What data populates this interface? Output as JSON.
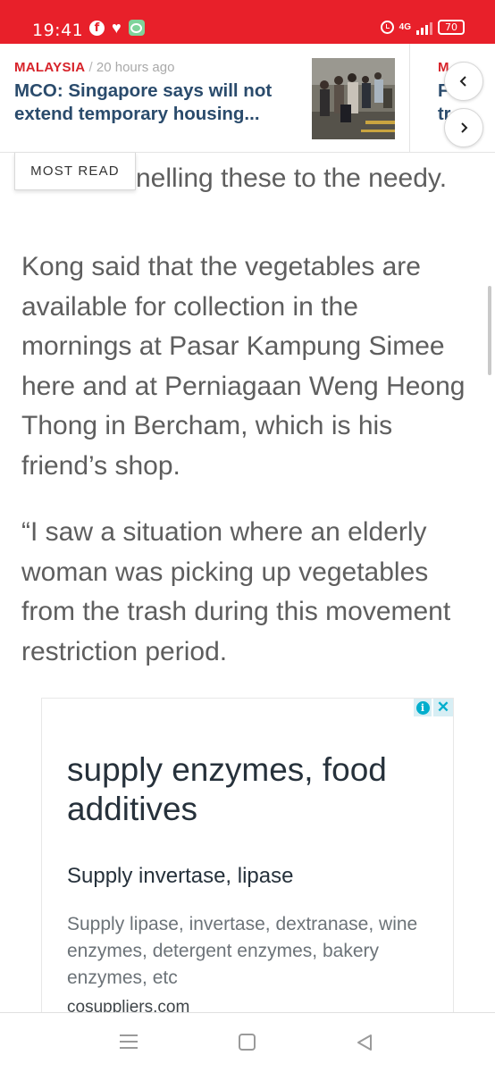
{
  "status_bar": {
    "time": "19:41",
    "network": "4G",
    "battery": "70",
    "icons": [
      "facebook-icon",
      "heart-icon",
      "chat-icon",
      "alarm-icon",
      "signal-icon",
      "battery-icon"
    ]
  },
  "ticker": {
    "category": "MALAYSIA",
    "separator": "/",
    "time_ago": "20 hours ago",
    "headline": "MCO: Singapore says will not extend temporary housing...",
    "peek_category": "M",
    "peek_line1": "F",
    "peek_line2": "tr",
    "prev_icon": "chevron-left-icon",
    "next_icon": "chevron-right-icon"
  },
  "most_read": {
    "label": "MOST READ"
  },
  "article": {
    "partial_line": "nelling these to the needy.",
    "paragraph_1": "Kong said that the vegetables are available for collection in the mornings at Pasar Kampung Simee here and at Perniagaan Weng Heong Thong in Bercham, which is his friend’s shop.",
    "paragraph_2": "“I saw a situation where an elderly woman was picking up vegetables from the trash during this movement restriction period."
  },
  "ad": {
    "title": "supply enzymes, food additives",
    "subtitle": "Supply invertase, lipase",
    "body": "Supply lipase, invertase, dextranase, wine enzymes, detergent enzymes, bakery enzymes, etc",
    "domain": "cosuppliers.com",
    "info_glyph": "i",
    "close_glyph": "✕"
  },
  "colors": {
    "brand_red": "#e8202a",
    "headline_blue": "#2a4b6c",
    "body_text": "#5e5e5e",
    "ad_accent": "#00aecd"
  }
}
